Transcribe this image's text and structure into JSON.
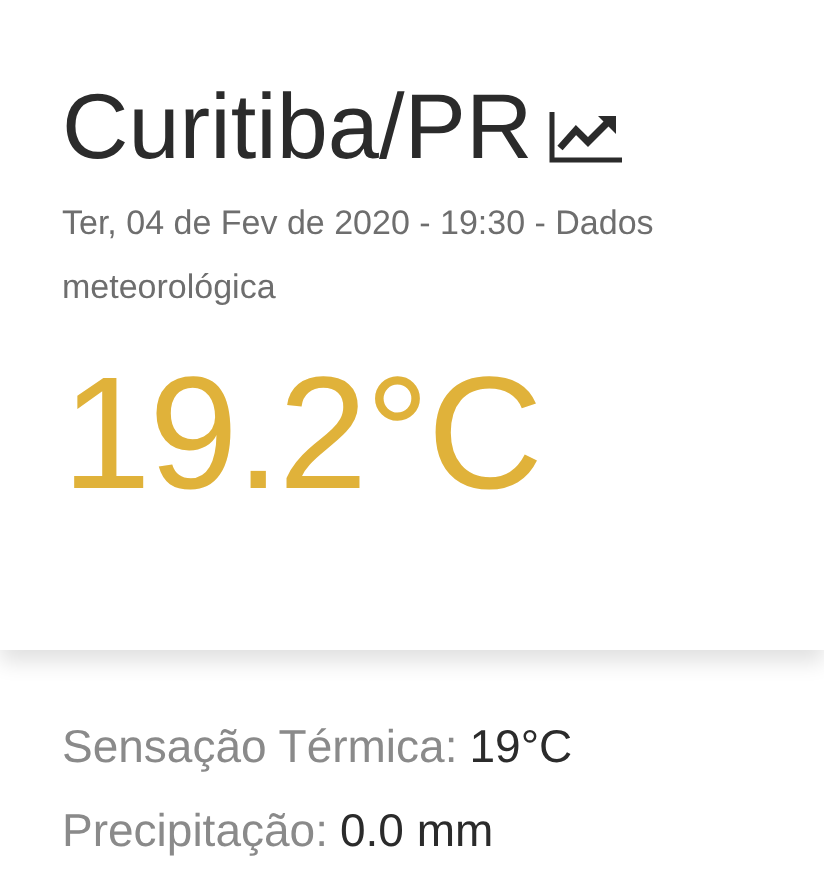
{
  "city": "Curitiba/PR",
  "subtitle": "Ter, 04 de Fev de 2020 - 19:30 - Dados meteorológica",
  "temperature": "19.2°C",
  "details": [
    {
      "label": "Sensação Térmica:",
      "value": "19°C"
    },
    {
      "label": "Precipitação:",
      "value": "0.0 mm"
    }
  ]
}
